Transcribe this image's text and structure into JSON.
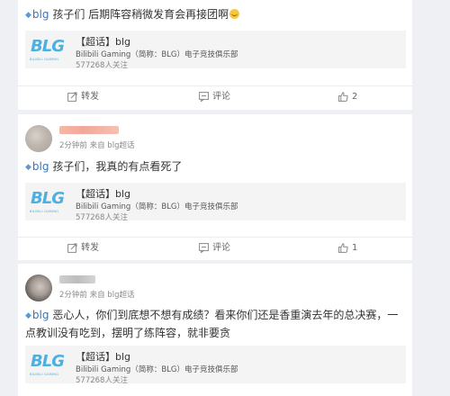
{
  "posts": [
    {
      "topic": "blg",
      "text": " 孩子们 后期阵容稍微发育会再接团啊",
      "emoji": "smile-emoji",
      "supergroup": {
        "logo": "BLG",
        "logo_sub": "BILIBILI GAMING",
        "title": "【超话】blg",
        "desc": "Bilibili Gaming（简称：BLG）电子竞技俱乐部",
        "count": "577268人关注"
      },
      "actions": {
        "forward": "转发",
        "comment": "评论",
        "like": "2"
      }
    },
    {
      "meta": "2分钟前 来自 blg超话",
      "topic": "blg",
      "text": " 孩子们，我真的有点看死了",
      "supergroup": {
        "logo": "BLG",
        "logo_sub": "BILIBILI GAMING",
        "title": "【超话】blg",
        "desc": "Bilibili Gaming（简称：BLG）电子竞技俱乐部",
        "count": "577268人关注"
      },
      "actions": {
        "forward": "转发",
        "comment": "评论",
        "like": "1"
      }
    },
    {
      "meta": "2分钟前 来自 blg超话",
      "topic": "blg",
      "text": " 恶心人，你们到底想不想有成绩？看来你们还是香重演去年的总决赛，一点教训没有吃到，摆明了练阵容，就非要贪",
      "supergroup": {
        "logo": "BLG",
        "logo_sub": "BILIBILI GAMING",
        "title": "【超话】blg",
        "desc": "Bilibili Gaming（简称：BLG）电子竞技俱乐部",
        "count": "577268人关注"
      }
    }
  ],
  "colors": {
    "topic": "#3a73b8",
    "logo": "#4cb0e0",
    "card_bg": "#ffffff",
    "page_bg": "#eef0f3"
  }
}
